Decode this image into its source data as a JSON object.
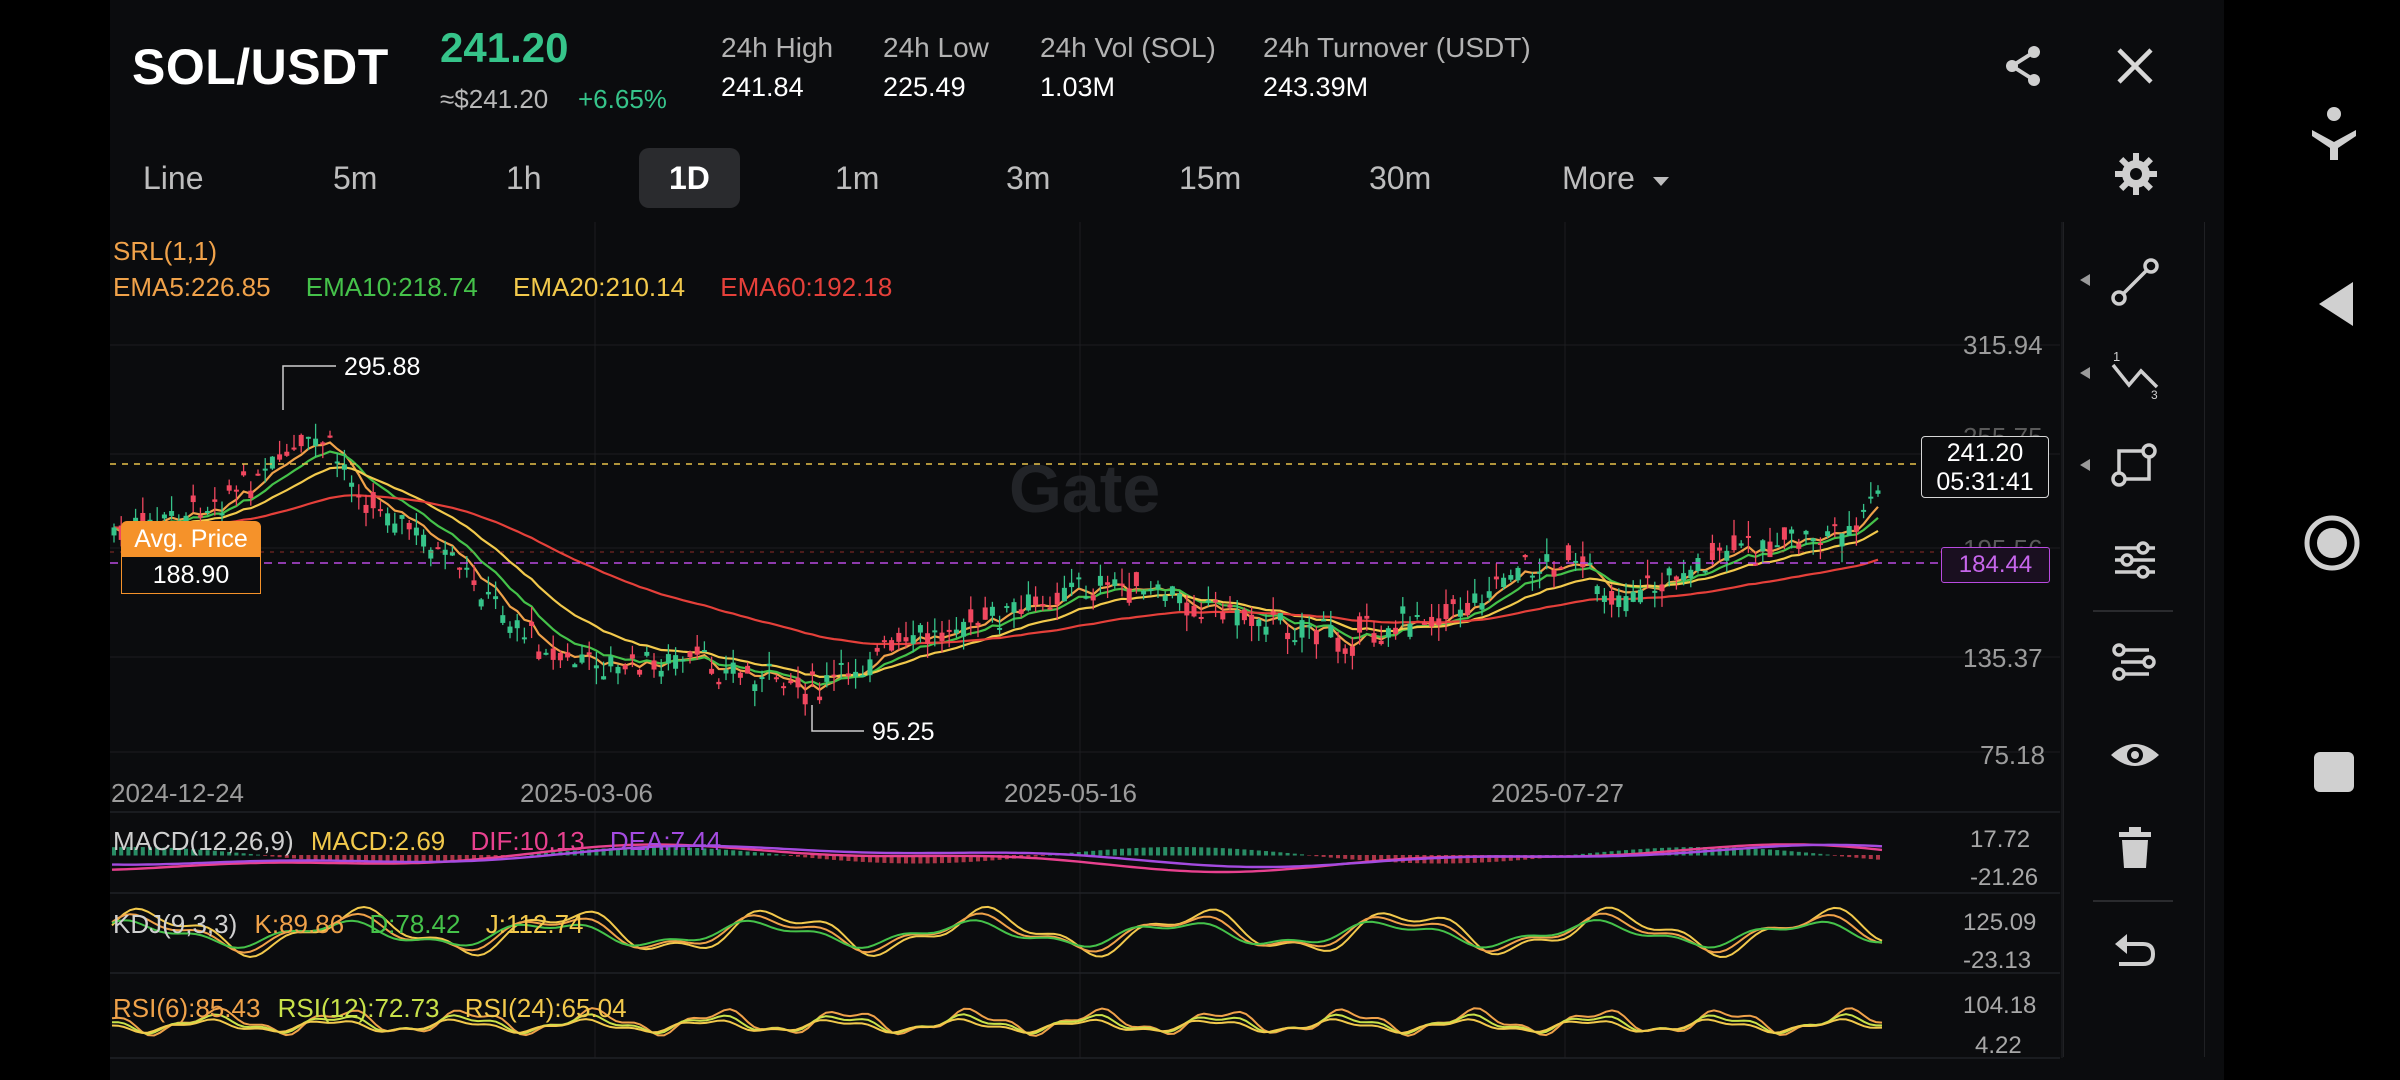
{
  "header": {
    "pair": "SOL/USDT",
    "last_price": "241.20",
    "usd_price": "≈$241.20",
    "change": "+6.65%",
    "stats": [
      {
        "label": "24h High",
        "value": "241.84"
      },
      {
        "label": "24h Low",
        "value": "225.49"
      },
      {
        "label": "24h Vol (SOL)",
        "value": "1.03M"
      },
      {
        "label": "24h Turnover (USDT)",
        "value": "243.39M"
      }
    ]
  },
  "tabs": [
    "Line",
    "5m",
    "1h",
    "1D",
    "1m",
    "3m",
    "15m",
    "30m",
    "More"
  ],
  "active_tab": "1D",
  "watermark": "Gate",
  "main_chart": {
    "srl_label": "SRL(1,1)",
    "ema": [
      {
        "label": "EMA5:226.85",
        "color": "#f0a24a"
      },
      {
        "label": "EMA10:218.74",
        "color": "#45c24a"
      },
      {
        "label": "EMA20:210.14",
        "color": "#f2c94c"
      },
      {
        "label": "EMA60:192.18",
        "color": "#e5403a"
      }
    ],
    "y_ticks": [
      "315.94",
      "255.75",
      "195.56",
      "135.37",
      "75.18"
    ],
    "x_ticks": [
      "2024-12-24",
      "2025-03-06",
      "2025-05-16",
      "2025-07-27"
    ],
    "high_marker": "295.88",
    "low_marker": "95.25",
    "avg_price_label": "Avg. Price",
    "avg_price_value": "188.90",
    "current_price": "241.20",
    "countdown": "05:31:41",
    "purple_level": "184.44"
  },
  "indicators": {
    "macd": {
      "legend": [
        {
          "text": "MACD(12,26,9)",
          "color": "#d0d0d0"
        },
        {
          "text": "MACD:2.69",
          "color": "#f2c94c"
        },
        {
          "text": "DIF:10.13",
          "color": "#e8418f"
        },
        {
          "text": "DEA:7.44",
          "color": "#a44be0"
        }
      ],
      "ticks": [
        "17.72",
        "-21.26"
      ]
    },
    "kdj": {
      "legend": [
        {
          "text": "KDJ(9,3,3)",
          "color": "#d0d0d0"
        },
        {
          "text": "K:89.86",
          "color": "#f0a24a"
        },
        {
          "text": "D:78.42",
          "color": "#45c24a"
        },
        {
          "text": "J:112.74",
          "color": "#f2c94c"
        }
      ],
      "ticks": [
        "125.09",
        "-23.13"
      ]
    },
    "rsi": {
      "legend": [
        {
          "text": "RSI(6):85.43",
          "color": "#f0a24a"
        },
        {
          "text": "RSI(12):72.73",
          "color": "#c9e24a"
        },
        {
          "text": "RSI(24):65.04",
          "color": "#f2c94c"
        }
      ],
      "ticks": [
        "104.18",
        "4.22"
      ]
    }
  },
  "colors": {
    "up": "#36c48a",
    "down": "#f0475f",
    "accent_orange": "#f5922a",
    "purple": "#b94be0"
  }
}
